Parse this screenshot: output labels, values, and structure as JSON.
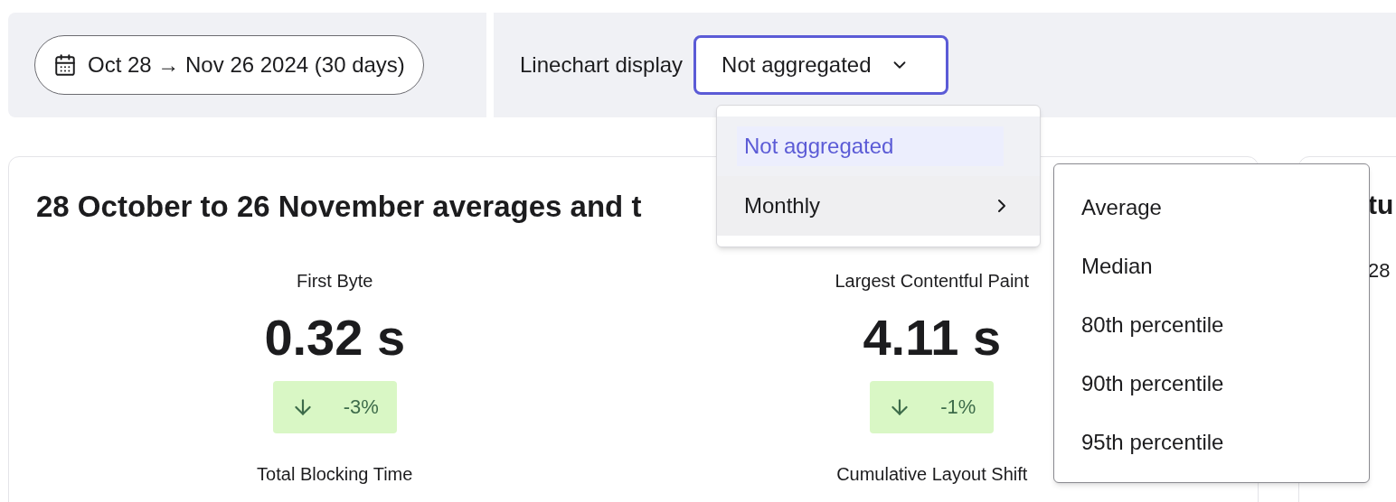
{
  "date_range": {
    "label": "Oct 28 → Nov 26 2024 (30 days)"
  },
  "linechart": {
    "label": "Linechart display",
    "value": "Not aggregated",
    "expanded": true,
    "options": [
      {
        "label": "Not aggregated",
        "selected": true,
        "submenu": false
      },
      {
        "label": "Monthly",
        "selected": false,
        "submenu": true
      }
    ],
    "submenu": [
      "Average",
      "Median",
      "80th percentile",
      "90th percentile",
      "95th percentile"
    ]
  },
  "card": {
    "title": "28 October to 26 November averages and t",
    "metrics": [
      {
        "name": "First Byte",
        "value": "0.32 s",
        "delta": "-3%"
      },
      {
        "name": "Largest Contentful Paint",
        "value": "4.11 s",
        "delta": "-1%"
      },
      {
        "name": "Total Blocking Time"
      },
      {
        "name": "Cumulative Layout Shift"
      }
    ]
  },
  "side_card": {
    "title": "tu",
    "subtitle": "28"
  }
}
